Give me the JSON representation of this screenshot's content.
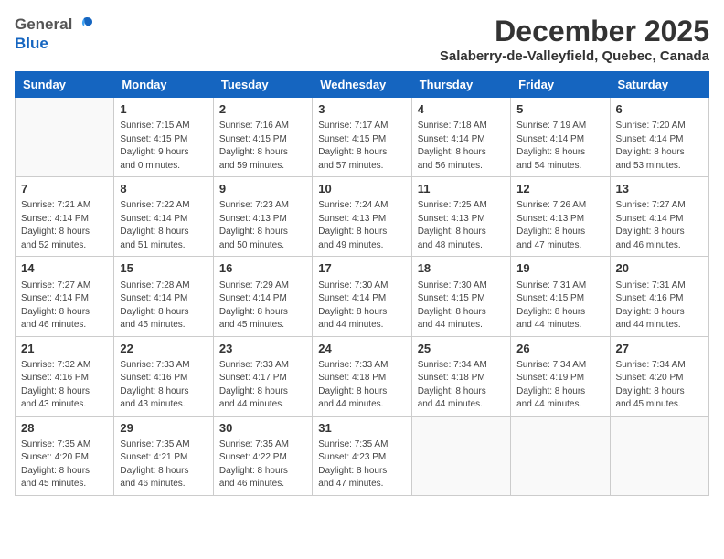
{
  "header": {
    "logo_general": "General",
    "logo_blue": "Blue",
    "month": "December 2025",
    "location": "Salaberry-de-Valleyfield, Quebec, Canada"
  },
  "weekdays": [
    "Sunday",
    "Monday",
    "Tuesday",
    "Wednesday",
    "Thursday",
    "Friday",
    "Saturday"
  ],
  "weeks": [
    [
      {
        "day": "",
        "info": ""
      },
      {
        "day": "1",
        "info": "Sunrise: 7:15 AM\nSunset: 4:15 PM\nDaylight: 9 hours\nand 0 minutes."
      },
      {
        "day": "2",
        "info": "Sunrise: 7:16 AM\nSunset: 4:15 PM\nDaylight: 8 hours\nand 59 minutes."
      },
      {
        "day": "3",
        "info": "Sunrise: 7:17 AM\nSunset: 4:15 PM\nDaylight: 8 hours\nand 57 minutes."
      },
      {
        "day": "4",
        "info": "Sunrise: 7:18 AM\nSunset: 4:14 PM\nDaylight: 8 hours\nand 56 minutes."
      },
      {
        "day": "5",
        "info": "Sunrise: 7:19 AM\nSunset: 4:14 PM\nDaylight: 8 hours\nand 54 minutes."
      },
      {
        "day": "6",
        "info": "Sunrise: 7:20 AM\nSunset: 4:14 PM\nDaylight: 8 hours\nand 53 minutes."
      }
    ],
    [
      {
        "day": "7",
        "info": "Sunrise: 7:21 AM\nSunset: 4:14 PM\nDaylight: 8 hours\nand 52 minutes."
      },
      {
        "day": "8",
        "info": "Sunrise: 7:22 AM\nSunset: 4:14 PM\nDaylight: 8 hours\nand 51 minutes."
      },
      {
        "day": "9",
        "info": "Sunrise: 7:23 AM\nSunset: 4:13 PM\nDaylight: 8 hours\nand 50 minutes."
      },
      {
        "day": "10",
        "info": "Sunrise: 7:24 AM\nSunset: 4:13 PM\nDaylight: 8 hours\nand 49 minutes."
      },
      {
        "day": "11",
        "info": "Sunrise: 7:25 AM\nSunset: 4:13 PM\nDaylight: 8 hours\nand 48 minutes."
      },
      {
        "day": "12",
        "info": "Sunrise: 7:26 AM\nSunset: 4:13 PM\nDaylight: 8 hours\nand 47 minutes."
      },
      {
        "day": "13",
        "info": "Sunrise: 7:27 AM\nSunset: 4:14 PM\nDaylight: 8 hours\nand 46 minutes."
      }
    ],
    [
      {
        "day": "14",
        "info": "Sunrise: 7:27 AM\nSunset: 4:14 PM\nDaylight: 8 hours\nand 46 minutes."
      },
      {
        "day": "15",
        "info": "Sunrise: 7:28 AM\nSunset: 4:14 PM\nDaylight: 8 hours\nand 45 minutes."
      },
      {
        "day": "16",
        "info": "Sunrise: 7:29 AM\nSunset: 4:14 PM\nDaylight: 8 hours\nand 45 minutes."
      },
      {
        "day": "17",
        "info": "Sunrise: 7:30 AM\nSunset: 4:14 PM\nDaylight: 8 hours\nand 44 minutes."
      },
      {
        "day": "18",
        "info": "Sunrise: 7:30 AM\nSunset: 4:15 PM\nDaylight: 8 hours\nand 44 minutes."
      },
      {
        "day": "19",
        "info": "Sunrise: 7:31 AM\nSunset: 4:15 PM\nDaylight: 8 hours\nand 44 minutes."
      },
      {
        "day": "20",
        "info": "Sunrise: 7:31 AM\nSunset: 4:16 PM\nDaylight: 8 hours\nand 44 minutes."
      }
    ],
    [
      {
        "day": "21",
        "info": "Sunrise: 7:32 AM\nSunset: 4:16 PM\nDaylight: 8 hours\nand 43 minutes."
      },
      {
        "day": "22",
        "info": "Sunrise: 7:33 AM\nSunset: 4:16 PM\nDaylight: 8 hours\nand 43 minutes."
      },
      {
        "day": "23",
        "info": "Sunrise: 7:33 AM\nSunset: 4:17 PM\nDaylight: 8 hours\nand 44 minutes."
      },
      {
        "day": "24",
        "info": "Sunrise: 7:33 AM\nSunset: 4:18 PM\nDaylight: 8 hours\nand 44 minutes."
      },
      {
        "day": "25",
        "info": "Sunrise: 7:34 AM\nSunset: 4:18 PM\nDaylight: 8 hours\nand 44 minutes."
      },
      {
        "day": "26",
        "info": "Sunrise: 7:34 AM\nSunset: 4:19 PM\nDaylight: 8 hours\nand 44 minutes."
      },
      {
        "day": "27",
        "info": "Sunrise: 7:34 AM\nSunset: 4:20 PM\nDaylight: 8 hours\nand 45 minutes."
      }
    ],
    [
      {
        "day": "28",
        "info": "Sunrise: 7:35 AM\nSunset: 4:20 PM\nDaylight: 8 hours\nand 45 minutes."
      },
      {
        "day": "29",
        "info": "Sunrise: 7:35 AM\nSunset: 4:21 PM\nDaylight: 8 hours\nand 46 minutes."
      },
      {
        "day": "30",
        "info": "Sunrise: 7:35 AM\nSunset: 4:22 PM\nDaylight: 8 hours\nand 46 minutes."
      },
      {
        "day": "31",
        "info": "Sunrise: 7:35 AM\nSunset: 4:23 PM\nDaylight: 8 hours\nand 47 minutes."
      },
      {
        "day": "",
        "info": ""
      },
      {
        "day": "",
        "info": ""
      },
      {
        "day": "",
        "info": ""
      }
    ]
  ]
}
